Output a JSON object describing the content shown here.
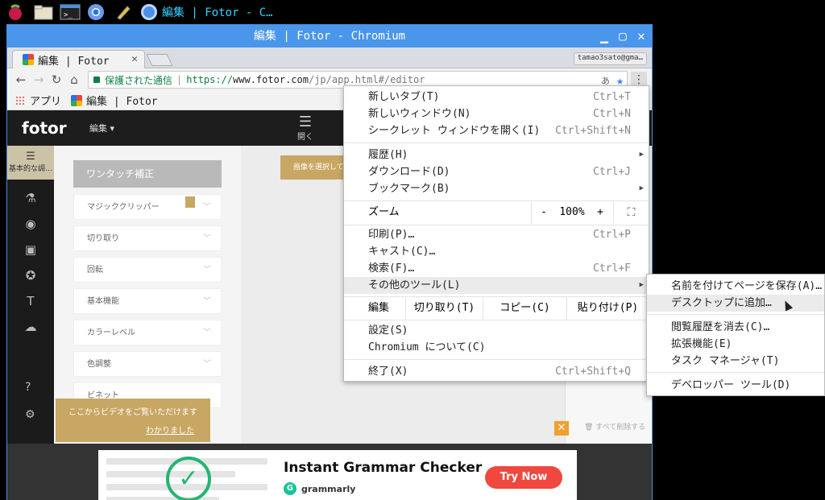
{
  "taskbar": {
    "icons": [
      "raspberry-icon",
      "folder-icon",
      "terminal-icon",
      "chromium-icon",
      "pencil-icon"
    ],
    "active_window": "編集 | Fotor - C…"
  },
  "window": {
    "title": "編集 | Fotor - Chromium"
  },
  "tab": {
    "title": "編集 | Fotor",
    "profile": "tamao3sato@gma…"
  },
  "omnibox": {
    "secure_label": "保護された通信",
    "url_scheme": "https://",
    "url_host": "www.fotor.com",
    "url_path": "/jp/app.html#/editor"
  },
  "bookmarks": {
    "apps": "アプリ",
    "item1": "編集 | Fotor"
  },
  "fotor": {
    "logo": "fotor",
    "edit_menu": "編集 ▾",
    "open_label": "開く",
    "sidebar_top": "基本的な調…",
    "one_touch": "ワンタッチ補正",
    "sections": [
      "マジッククリッパー",
      "切り取り",
      "回転",
      "基本機能",
      "カラーレベル",
      "色調整",
      "ビネット"
    ],
    "open_tooltip": "画像を選択して",
    "delete_all": "すべて削除する",
    "video_tip": "ここからビデオをご覧いただけます",
    "video_tip_link": "わかりました"
  },
  "ad": {
    "title": "Instant Grammar Checker",
    "brand": "grammarly",
    "cta": "Try Now",
    "close": "✕"
  },
  "menu": {
    "new_tab": "新しいタブ(T)",
    "new_tab_sc": "Ctrl+T",
    "new_window": "新しいウィンドウ(N)",
    "new_window_sc": "Ctrl+N",
    "incognito": "シークレット ウィンドウを開く(I)",
    "incognito_sc": "Ctrl+Shift+N",
    "history": "履歴(H)",
    "downloads": "ダウンロード(D)",
    "downloads_sc": "Ctrl+J",
    "bookmarks": "ブックマーク(B)",
    "zoom": "ズーム",
    "zoom_minus": "-",
    "zoom_value": "100%",
    "zoom_plus": "+",
    "print": "印刷(P)…",
    "print_sc": "Ctrl+P",
    "cast": "キャスト(C)…",
    "find": "検索(F)…",
    "find_sc": "Ctrl+F",
    "more_tools": "その他のツール(L)",
    "edit": "編集",
    "cut": "切り取り(T)",
    "copy": "コピー(C)",
    "paste": "貼り付け(P)",
    "settings": "設定(S)",
    "about": "Chromium について(C)",
    "exit": "終了(X)",
    "exit_sc": "Ctrl+Shift+Q"
  },
  "submenu": {
    "save_as": "名前を付けてページを保存(A)…",
    "add_desktop": "デスクトップに追加…",
    "clear_data": "閲覧履歴を消去(C)…",
    "extensions": "拡張機能(E)",
    "task_manager": "タスク マネージャ(T)",
    "dev_tools": "デベロッパー ツール(D)"
  }
}
